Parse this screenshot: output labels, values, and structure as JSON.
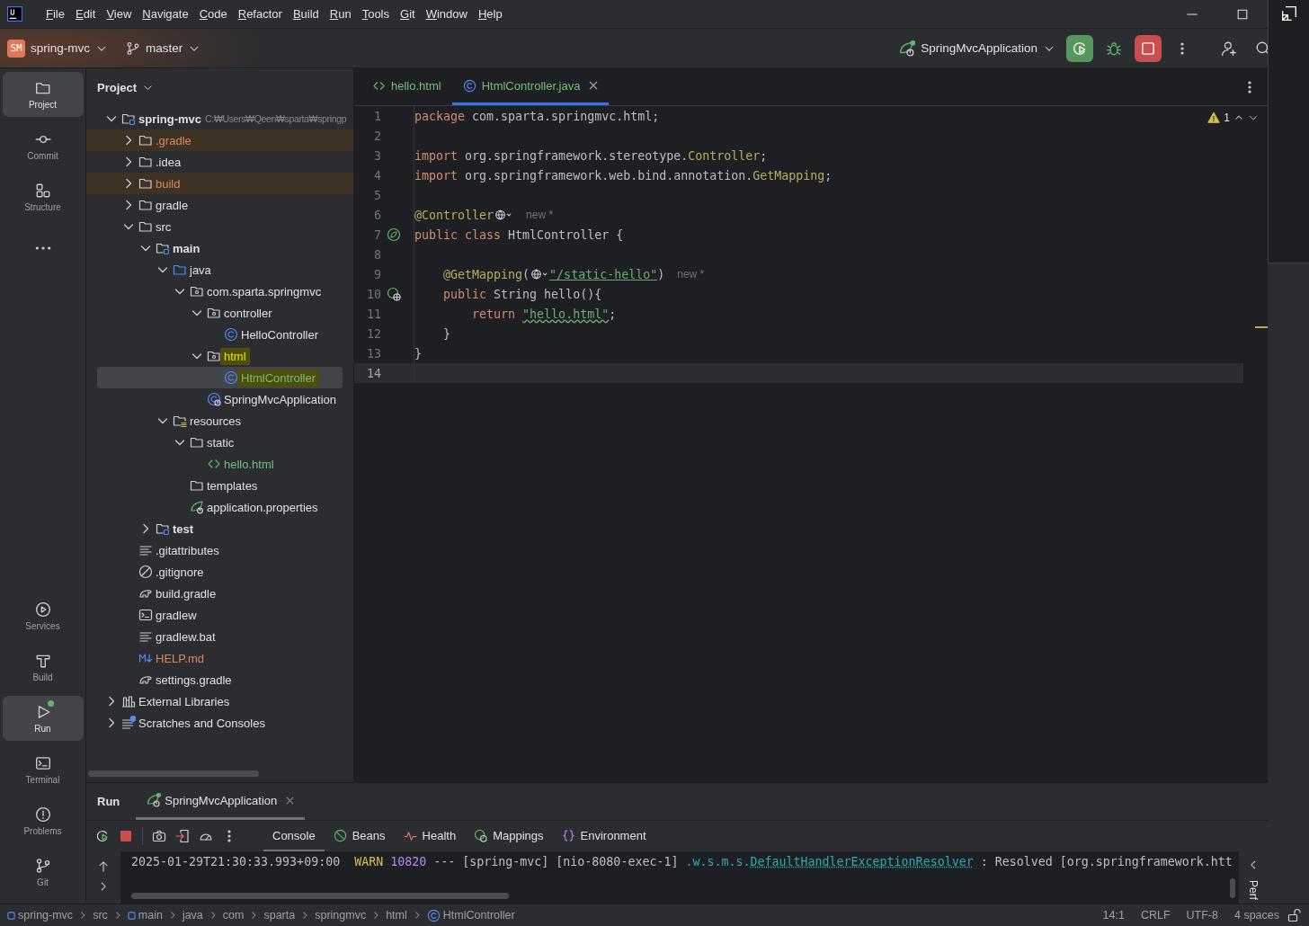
{
  "menu_bar": {
    "items": [
      "File",
      "Edit",
      "View",
      "Navigate",
      "Code",
      "Refactor",
      "Build",
      "Run",
      "Tools",
      "Git",
      "Window",
      "Help"
    ]
  },
  "toolbar": {
    "project": {
      "badge": "SM",
      "name": "spring-mvc"
    },
    "branch": "master",
    "run_config": "SpringMvcApplication"
  },
  "tool_stripe": {
    "top": [
      {
        "label": "Project",
        "selected": true,
        "badge": false
      },
      {
        "label": "Commit",
        "selected": false,
        "badge": false
      },
      {
        "label": "Structure",
        "selected": false,
        "badge": false
      },
      {
        "selected": false,
        "badge": false
      }
    ],
    "bottom": [
      {
        "label": "Services",
        "selected": false,
        "badge": false
      },
      {
        "label": "Build",
        "selected": false,
        "badge": false
      },
      {
        "label": "Run",
        "selected": true,
        "badge": true
      },
      {
        "label": "Terminal",
        "selected": false,
        "badge": false
      },
      {
        "label": "Problems",
        "selected": false,
        "badge": false
      },
      {
        "label": "Git",
        "selected": false,
        "badge": false
      }
    ]
  },
  "project_panel": {
    "title": "Project",
    "tree": [
      {
        "label": "spring-mvc",
        "path": "C:₩Users₩Qeen₩sparta₩springp",
        "kind": "module",
        "expanded": true,
        "selected": false,
        "highlighted": false,
        "children": [
          {
            "label": ".gradle",
            "kind": "excluded-folder",
            "color": "#d6895f",
            "expanded": false,
            "selected": false,
            "highlighted": false
          },
          {
            "label": ".idea",
            "kind": "folder",
            "expanded": false,
            "selected": false,
            "highlighted": false
          },
          {
            "label": "build",
            "kind": "excluded-folder",
            "color": "#d6895f",
            "expanded": false,
            "selected": false,
            "highlighted": false
          },
          {
            "label": "gradle",
            "kind": "folder",
            "expanded": false,
            "selected": false,
            "highlighted": false
          },
          {
            "label": "src",
            "kind": "folder",
            "expanded": true,
            "selected": false,
            "highlighted": false,
            "children": [
              {
                "label": "main",
                "kind": "module",
                "expanded": true,
                "selected": false,
                "highlighted": false,
                "children": [
                  {
                    "label": "java",
                    "kind": "java-root",
                    "expanded": true,
                    "selected": false,
                    "highlighted": false,
                    "children": [
                      {
                        "label": "com.sparta.springmvc",
                        "kind": "package",
                        "expanded": true,
                        "selected": false,
                        "highlighted": false,
                        "children": [
                          {
                            "label": "controller",
                            "kind": "package",
                            "expanded": true,
                            "selected": false,
                            "highlighted": false,
                            "children": [
                              {
                                "label": "HelloController",
                                "kind": "class",
                                "selected": false,
                                "highlighted": false
                              }
                            ]
                          },
                          {
                            "label": "html",
                            "kind": "package",
                            "expanded": true,
                            "selected": false,
                            "highlighted": true,
                            "children": [
                              {
                                "label": "HtmlController",
                                "kind": "class",
                                "color": "#73bd79",
                                "selected": true,
                                "highlighted": true
                              }
                            ]
                          },
                          {
                            "label": "SpringMvcApplication",
                            "kind": "spring-class",
                            "selected": false,
                            "highlighted": false
                          }
                        ]
                      }
                    ]
                  },
                  {
                    "label": "resources",
                    "kind": "resources",
                    "expanded": true,
                    "selected": false,
                    "highlighted": false,
                    "children": [
                      {
                        "label": "static",
                        "kind": "folder",
                        "expanded": true,
                        "selected": false,
                        "highlighted": false,
                        "children": [
                          {
                            "label": "hello.html",
                            "kind": "html",
                            "color": "#73bd79",
                            "selected": false,
                            "highlighted": false
                          }
                        ]
                      },
                      {
                        "label": "templates",
                        "kind": "folder",
                        "selected": false,
                        "highlighted": false
                      },
                      {
                        "label": "application.properties",
                        "kind": "spring",
                        "selected": false,
                        "highlighted": false
                      }
                    ]
                  }
                ]
              },
              {
                "label": "test",
                "kind": "module",
                "expanded": false,
                "selected": false,
                "highlighted": false
              }
            ]
          },
          {
            "label": ".gitattributes",
            "kind": "text",
            "selected": false,
            "highlighted": false
          },
          {
            "label": ".gitignore",
            "kind": "ignore",
            "selected": false,
            "highlighted": false
          },
          {
            "label": "build.gradle",
            "kind": "gradle",
            "selected": false,
            "highlighted": false
          },
          {
            "label": "gradlew",
            "kind": "terminal",
            "selected": false,
            "highlighted": false
          },
          {
            "label": "gradlew.bat",
            "kind": "text",
            "selected": false,
            "highlighted": false
          },
          {
            "label": "HELP.md",
            "kind": "markdown",
            "color": "#d6895f",
            "selected": false,
            "highlighted": false
          },
          {
            "label": "settings.gradle",
            "kind": "gradle",
            "selected": false,
            "highlighted": false
          }
        ]
      },
      {
        "label": "External Libraries",
        "kind": "libraries",
        "expanded": false,
        "selected": false,
        "highlighted": false
      },
      {
        "label": "Scratches and Consoles",
        "kind": "scratches",
        "expanded": false,
        "selected": false,
        "highlighted": false
      }
    ]
  },
  "editor": {
    "tabs": [
      {
        "label": "hello.html",
        "kind": "html",
        "selected": false
      },
      {
        "label": "HtmlController.java",
        "kind": "class",
        "selected": true
      }
    ],
    "warnings": "1",
    "lines": [
      {
        "number": "1",
        "kind": "plain",
        "current": false,
        "segments": [
          {
            "text": "package",
            "kind": "keyword"
          },
          {
            "text": " com.sparta.springmvc.html;",
            "kind": "plain"
          }
        ]
      },
      {
        "number": "2",
        "kind": "plain",
        "current": false
      },
      {
        "number": "3",
        "kind": "plain",
        "current": false,
        "segments": [
          {
            "text": "import",
            "kind": "keyword"
          },
          {
            "text": " org.springframework.stereotype.",
            "kind": "plain"
          },
          {
            "text": "Controller",
            "kind": "annotation"
          },
          {
            "text": ";",
            "kind": "plain"
          }
        ]
      },
      {
        "number": "4",
        "kind": "plain",
        "current": false,
        "segments": [
          {
            "text": "import",
            "kind": "keyword"
          },
          {
            "text": " org.springframework.web.bind.annotation.",
            "kind": "plain"
          },
          {
            "text": "GetMapping",
            "kind": "annotation"
          },
          {
            "text": ";",
            "kind": "plain"
          }
        ]
      },
      {
        "number": "5",
        "kind": "plain",
        "current": false
      },
      {
        "number": "6",
        "kind": "plain",
        "current": false,
        "segments": [
          {
            "text": "@Controller",
            "kind": "annotation"
          },
          {
            "kind": "globe"
          },
          {
            "text": "new *",
            "kind": "hint"
          }
        ]
      },
      {
        "number": "7",
        "kind": "bean",
        "current": false,
        "segments": [
          {
            "text": "public class",
            "kind": "keyword"
          },
          {
            "text": " HtmlController {",
            "kind": "plain"
          }
        ]
      },
      {
        "number": "8",
        "kind": "plain",
        "current": false
      },
      {
        "number": "9",
        "kind": "plain",
        "current": false,
        "segments": [
          {
            "text": "    @GetMapping",
            "kind": "annotation"
          },
          {
            "text": "(",
            "kind": "plain"
          },
          {
            "kind": "globe"
          },
          {
            "text": "\"/static-hello\"",
            "kind": "url"
          },
          {
            "text": ")",
            "kind": "plain"
          },
          {
            "text": "new *",
            "kind": "hint"
          }
        ]
      },
      {
        "number": "10",
        "kind": "web",
        "current": false,
        "segments": [
          {
            "text": "    public",
            "kind": "keyword"
          },
          {
            "text": " String hello(){",
            "kind": "plain"
          }
        ]
      },
      {
        "number": "11",
        "kind": "plain",
        "current": false,
        "segments": [
          {
            "text": "        return ",
            "kind": "keyword"
          },
          {
            "text": "\"hello.html\"",
            "kind": "typo-string"
          },
          {
            "text": ";",
            "kind": "plain"
          }
        ]
      },
      {
        "number": "12",
        "kind": "plain",
        "current": false,
        "segments": [
          {
            "text": "    }",
            "kind": "plain"
          }
        ]
      },
      {
        "number": "13",
        "kind": "plain",
        "current": false,
        "segments": [
          {
            "text": "}",
            "kind": "plain"
          }
        ]
      },
      {
        "number": "14",
        "kind": "plain",
        "current": true
      }
    ]
  },
  "run_panel": {
    "title": "Run",
    "tabs": [
      {
        "label": "SpringMvcApplication",
        "selected": true
      }
    ],
    "views": [
      {
        "label": "Console",
        "selected": true
      },
      {
        "label": "Beans",
        "selected": false
      },
      {
        "label": "Health",
        "selected": false
      },
      {
        "label": "Mappings",
        "selected": false
      },
      {
        "label": "Environment",
        "selected": false
      }
    ],
    "console": [
      [
        {
          "text": "2025-01-29T21:30:33.993+09:00  ",
          "kind": "plain"
        },
        {
          "text": "WARN ",
          "kind": "level"
        },
        {
          "text": "10820",
          "kind": "pid"
        },
        {
          "text": " --- [spring-mvc] [nio-8080-exec-1] ",
          "kind": "plain"
        },
        {
          "text": ".w.s.m.s.",
          "kind": "logger"
        },
        {
          "text": "DefaultHandlerExceptionResolver",
          "kind": "link"
        },
        {
          "text": " : Resolved [org.springframework.htt",
          "kind": "plain"
        }
      ]
    ],
    "side_label": "Perf"
  },
  "status_bar": {
    "breadcrumbs": [
      {
        "label": "spring-mvc",
        "kind": "module"
      },
      {
        "label": "src",
        "kind": "plain"
      },
      {
        "label": "main",
        "kind": "module"
      },
      {
        "label": "java",
        "kind": "plain"
      },
      {
        "label": "com",
        "kind": "plain"
      },
      {
        "label": "sparta",
        "kind": "plain"
      },
      {
        "label": "springmvc",
        "kind": "plain"
      },
      {
        "label": "html",
        "kind": "plain"
      },
      {
        "label": "HtmlController",
        "kind": "class"
      }
    ],
    "items": [
      "14:1",
      "CRLF",
      "UTF-8",
      "4 spaces"
    ]
  }
}
